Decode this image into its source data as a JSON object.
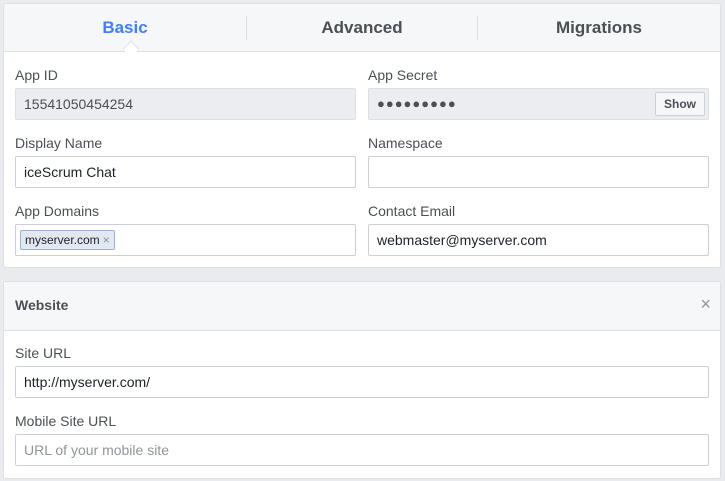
{
  "tabs": [
    {
      "label": "Basic",
      "active": true
    },
    {
      "label": "Advanced",
      "active": false
    },
    {
      "label": "Migrations",
      "active": false
    }
  ],
  "basic": {
    "app_id": {
      "label": "App ID",
      "value": "15541050454254"
    },
    "app_secret": {
      "label": "App Secret",
      "masked_value": "●●●●●●●●●",
      "show_label": "Show"
    },
    "display_name": {
      "label": "Display Name",
      "value": "iceScrum Chat"
    },
    "namespace": {
      "label": "Namespace",
      "value": ""
    },
    "app_domains": {
      "label": "App Domains",
      "tokens": [
        "myserver.com"
      ],
      "remove_glyph": "×"
    },
    "contact_email": {
      "label": "Contact Email",
      "value": "webmaster@myserver.com"
    }
  },
  "website": {
    "title": "Website",
    "close_glyph": "×",
    "site_url": {
      "label": "Site URL",
      "value": "http://myserver.com/"
    },
    "mobile_site_url": {
      "label": "Mobile Site URL",
      "value": "",
      "placeholder": "URL of your mobile site"
    }
  },
  "colors": {
    "accent": "#4080ff",
    "background": "#e9ebee",
    "border": "#dddfe2"
  },
  "icons": {
    "remove_token": "close-icon",
    "close_panel": "close-icon"
  }
}
